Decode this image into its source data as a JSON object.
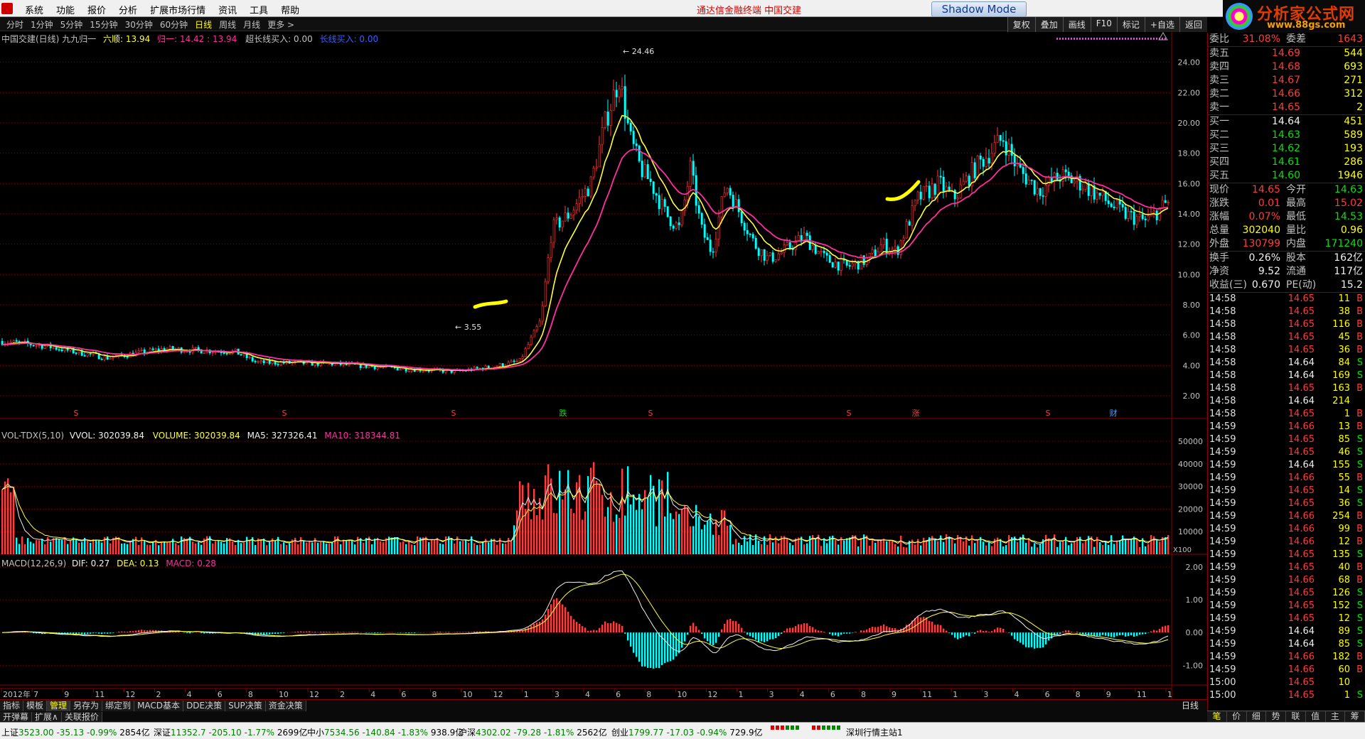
{
  "menubar": {
    "items": [
      "系统",
      "功能",
      "报价",
      "分析",
      "扩展市场行情",
      "资讯",
      "工具",
      "帮助"
    ],
    "brand": "通达信金融终端  中国交建",
    "shadow_mode": "Shadow Mode"
  },
  "sitelogo": {
    "title": "分析家公式网",
    "url": "www.88gs.com"
  },
  "periodbar": {
    "items": [
      "分时",
      "1分钟",
      "5分钟",
      "15分钟",
      "30分钟",
      "60分钟",
      "日线",
      "周线",
      "月线",
      "更多 >"
    ],
    "active": "日线",
    "tools": [
      "复权",
      "叠加",
      "画线",
      "F10",
      "标记",
      "+自选",
      "返回"
    ]
  },
  "main_pane": {
    "title_stock": "中国交建(日线)",
    "title_indicator": "九九归一",
    "ind1_label": "六顺: 13.94",
    "ind2_label": "归一: 14.42 : 13.94",
    "ind3_label": "超长线买入: 0.00",
    "ind4_label": "长线买入: 0.00",
    "high_label": "24.46",
    "low_label": "3.55",
    "y_ticks": [
      "24.00",
      "22.00",
      "20.00",
      "18.00",
      "16.00",
      "14.00",
      "12.00",
      "10.00",
      "8.00",
      "6.00",
      "4.00",
      "2.00"
    ],
    "markers": [
      {
        "label": "S",
        "color": "#ff3b3b"
      },
      {
        "label": "S",
        "color": "#ff3b3b"
      },
      {
        "label": "S",
        "color": "#ff3b3b"
      },
      {
        "label": "跌",
        "color": "#00e600"
      },
      {
        "label": "S",
        "color": "#ff3b3b"
      },
      {
        "label": "S",
        "color": "#ff3b3b"
      },
      {
        "label": "涨",
        "color": "#ff3b3b"
      },
      {
        "label": "S",
        "color": "#ff3b3b"
      },
      {
        "label": "财",
        "color": "#4aa0ff"
      }
    ]
  },
  "vol_pane": {
    "name": "VOL-TDX(5,10)",
    "vvol": "VVOL: 302039.84",
    "volume": "VOLUME: 302039.84",
    "ma5": "MA5: 327326.41",
    "ma10": "MA10: 318344.81",
    "y_ticks": [
      "50000",
      "40000",
      "30000",
      "20000",
      "10000"
    ],
    "unit": "X100"
  },
  "macd_pane": {
    "name": "MACD(12,26,9)",
    "dif": "DIF: 0.27",
    "dea": "DEA: 0.13",
    "macd": "MACD: 0.28",
    "y_ticks": [
      "2.00",
      "1.00",
      "0.00",
      "-1.00"
    ]
  },
  "x_axis": [
    "2012年",
    "7",
    "9",
    "11",
    "12",
    "2",
    "4",
    "6",
    "8",
    "10",
    "12",
    "2",
    "4",
    "6",
    "8",
    "10",
    "12",
    "1",
    "3",
    "4",
    "6",
    "8",
    "10",
    "12",
    "1",
    "3",
    "4",
    "6",
    "8",
    "9",
    "11",
    "1",
    "3",
    "4",
    "6",
    "8",
    "9",
    "11",
    "1"
  ],
  "tabs": {
    "row1": [
      "指标",
      "模板",
      "管理",
      "另存为",
      "绑定到",
      "MACD基本",
      "DDE决策",
      "SUP决策",
      "资金决策"
    ],
    "row1_active": "管理",
    "row2": [
      "开弹幕",
      "扩展∧",
      "关联报价"
    ],
    "period": "日线"
  },
  "quote": {
    "weibi": {
      "label": "委比",
      "value": "31.08%",
      "label2": "委差",
      "value2": "1643"
    },
    "sell": [
      {
        "label": "卖五",
        "price": "14.69",
        "vol": "544"
      },
      {
        "label": "卖四",
        "price": "14.68",
        "vol": "693"
      },
      {
        "label": "卖三",
        "price": "14.67",
        "vol": "271"
      },
      {
        "label": "卖二",
        "price": "14.66",
        "vol": "312"
      },
      {
        "label": "卖一",
        "price": "14.65",
        "vol": "2"
      }
    ],
    "buy": [
      {
        "label": "买一",
        "price": "14.64",
        "vol": "451"
      },
      {
        "label": "买二",
        "price": "14.63",
        "vol": "589"
      },
      {
        "label": "买三",
        "price": "14.62",
        "vol": "193"
      },
      {
        "label": "买四",
        "price": "14.61",
        "vol": "286"
      },
      {
        "label": "买五",
        "price": "14.60",
        "vol": "1946"
      }
    ],
    "stats": [
      {
        "l1": "现价",
        "v1": "14.65",
        "c1": "red",
        "l2": "今开",
        "v2": "14.63",
        "c2": "green"
      },
      {
        "l1": "涨跌",
        "v1": "0.01",
        "c1": "red",
        "l2": "最高",
        "v2": "15.02",
        "c2": "red"
      },
      {
        "l1": "涨幅",
        "v1": "0.07%",
        "c1": "red",
        "l2": "最低",
        "v2": "14.53",
        "c2": "green"
      },
      {
        "l1": "总量",
        "v1": "302040",
        "c1": "yellow",
        "l2": "量比",
        "v2": "0.96",
        "c2": "yellow"
      },
      {
        "l1": "外盘",
        "v1": "130799",
        "c1": "red",
        "l2": "内盘",
        "v2": "171240",
        "c2": "green"
      }
    ],
    "stats2": [
      {
        "l1": "换手",
        "v1": "0.26%",
        "c1": "white",
        "l2": "股本",
        "v2": "162亿",
        "c2": "white"
      },
      {
        "l1": "净资",
        "v1": "9.52",
        "c1": "white",
        "l2": "流通",
        "v2": "117亿",
        "c2": "white"
      },
      {
        "l1": "收益(三)",
        "v1": "0.670",
        "c1": "white",
        "l2": "PE(动)",
        "v2": "15.2",
        "c2": "white"
      }
    ],
    "ticks": [
      {
        "t": "14:58",
        "p": "14.65",
        "pc": "red",
        "v": "11",
        "d": "B"
      },
      {
        "t": "14:58",
        "p": "14.65",
        "pc": "red",
        "v": "38",
        "d": "B"
      },
      {
        "t": "14:58",
        "p": "14.65",
        "pc": "red",
        "v": "116",
        "d": "B"
      },
      {
        "t": "14:58",
        "p": "14.65",
        "pc": "red",
        "v": "45",
        "d": "B"
      },
      {
        "t": "14:58",
        "p": "14.65",
        "pc": "red",
        "v": "36",
        "d": "B"
      },
      {
        "t": "14:58",
        "p": "14.64",
        "pc": "white",
        "v": "84",
        "d": "S"
      },
      {
        "t": "14:58",
        "p": "14.64",
        "pc": "white",
        "v": "169",
        "d": "S"
      },
      {
        "t": "14:58",
        "p": "14.65",
        "pc": "red",
        "v": "163",
        "d": "B"
      },
      {
        "t": "14:58",
        "p": "14.64",
        "pc": "white",
        "v": "214",
        "d": ""
      },
      {
        "t": "14:58",
        "p": "14.65",
        "pc": "red",
        "v": "1",
        "d": "B"
      },
      {
        "t": "14:59",
        "p": "14.66",
        "pc": "red",
        "v": "13",
        "d": "B"
      },
      {
        "t": "14:59",
        "p": "14.65",
        "pc": "red",
        "v": "85",
        "d": "S"
      },
      {
        "t": "14:59",
        "p": "14.65",
        "pc": "red",
        "v": "46",
        "d": "S"
      },
      {
        "t": "14:59",
        "p": "14.64",
        "pc": "white",
        "v": "155",
        "d": "S"
      },
      {
        "t": "14:59",
        "p": "14.66",
        "pc": "red",
        "v": "55",
        "d": "B"
      },
      {
        "t": "14:59",
        "p": "14.65",
        "pc": "red",
        "v": "14",
        "d": "S"
      },
      {
        "t": "14:59",
        "p": "14.65",
        "pc": "red",
        "v": "36",
        "d": "S"
      },
      {
        "t": "14:59",
        "p": "14.66",
        "pc": "red",
        "v": "254",
        "d": "B"
      },
      {
        "t": "14:59",
        "p": "14.66",
        "pc": "red",
        "v": "99",
        "d": "B"
      },
      {
        "t": "14:59",
        "p": "14.66",
        "pc": "red",
        "v": "12",
        "d": "B"
      },
      {
        "t": "14:59",
        "p": "14.65",
        "pc": "red",
        "v": "135",
        "d": "S"
      },
      {
        "t": "14:59",
        "p": "14.65",
        "pc": "red",
        "v": "40",
        "d": "B"
      },
      {
        "t": "14:59",
        "p": "14.66",
        "pc": "red",
        "v": "68",
        "d": "B"
      },
      {
        "t": "14:59",
        "p": "14.65",
        "pc": "red",
        "v": "126",
        "d": "S"
      },
      {
        "t": "14:59",
        "p": "14.65",
        "pc": "red",
        "v": "152",
        "d": "S"
      },
      {
        "t": "14:59",
        "p": "14.65",
        "pc": "red",
        "v": "12",
        "d": "S"
      },
      {
        "t": "14:59",
        "p": "14.64",
        "pc": "white",
        "v": "89",
        "d": "S"
      },
      {
        "t": "14:59",
        "p": "14.64",
        "pc": "white",
        "v": "85",
        "d": "S"
      },
      {
        "t": "14:59",
        "p": "14.66",
        "pc": "red",
        "v": "182",
        "d": "B"
      },
      {
        "t": "14:59",
        "p": "14.66",
        "pc": "red",
        "v": "60",
        "d": "B"
      },
      {
        "t": "15:00",
        "p": "14.65",
        "pc": "red",
        "v": "10",
        "d": ""
      },
      {
        "t": "15:00",
        "p": "14.65",
        "pc": "red",
        "v": "1",
        "d": "S"
      }
    ],
    "tabs": [
      "笔",
      "价",
      "细",
      "势",
      "联",
      "值",
      "主",
      "筹"
    ],
    "tabs_active": "笔"
  },
  "status": {
    "sh": {
      "name": "上证",
      "val": "3523.00",
      "chg": "-35.13",
      "pct": "-0.99%",
      "amt": "2854亿"
    },
    "sz": {
      "name": "深证",
      "val": "11352.7",
      "chg": "-205.10",
      "pct": "-1.77%",
      "amt": "2699亿"
    },
    "zx": {
      "name": "中小",
      "val": "7534.56",
      "chg": "-140.84",
      "pct": "-1.83%",
      "amt": "938.9亿"
    },
    "hs": {
      "name": "沪深",
      "val": "4302.02",
      "chg": "-79.28",
      "pct": "-1.81%",
      "amt": "2562亿"
    },
    "cy": {
      "name": "创业",
      "val": "1799.77",
      "chg": "-17.03",
      "pct": "-0.94%",
      "amt": "729.9亿"
    },
    "server": "深圳行情主站1"
  },
  "colors": {
    "up": "#ff3b3b",
    "down": "#00ffff",
    "ma1": "#ffff3c",
    "ma2": "#ff2fa0",
    "grid": "#8b0000"
  }
}
